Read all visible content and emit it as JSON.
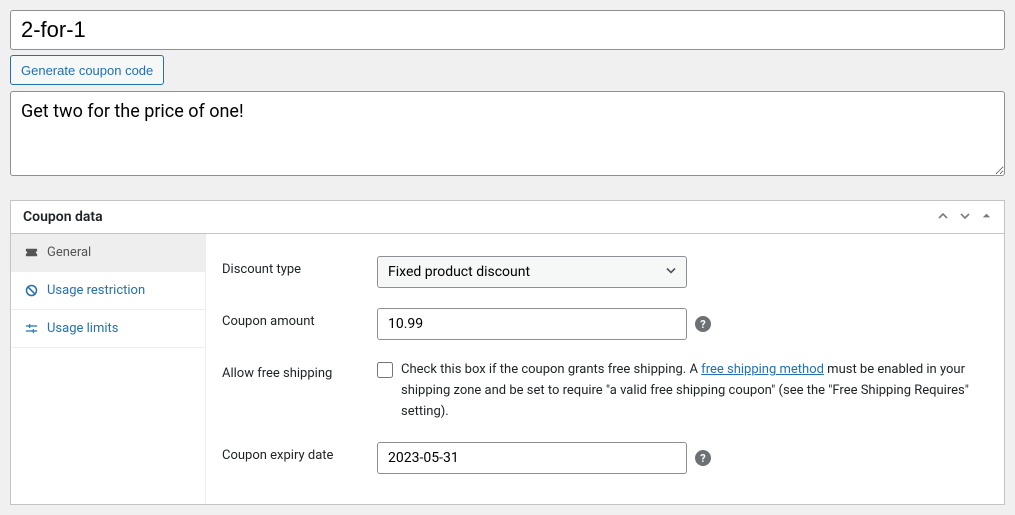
{
  "title": {
    "value": "2-for-1"
  },
  "generate_button": "Generate coupon code",
  "description": {
    "value": "Get two for the price of one!"
  },
  "panel": {
    "title": "Coupon data",
    "tabs": [
      {
        "label": "General"
      },
      {
        "label": "Usage restriction"
      },
      {
        "label": "Usage limits"
      }
    ],
    "fields": {
      "discount_type": {
        "label": "Discount type",
        "value": "Fixed product discount"
      },
      "coupon_amount": {
        "label": "Coupon amount",
        "value": "10.99"
      },
      "free_shipping": {
        "label": "Allow free shipping",
        "text_before": "Check this box if the coupon grants free shipping. A ",
        "link_text": "free shipping method",
        "text_after": " must be enabled in your shipping zone and be set to require \"a valid free shipping coupon\" (see the \"Free Shipping Requires\" setting)."
      },
      "expiry_date": {
        "label": "Coupon expiry date",
        "value": "2023-05-31"
      }
    }
  }
}
